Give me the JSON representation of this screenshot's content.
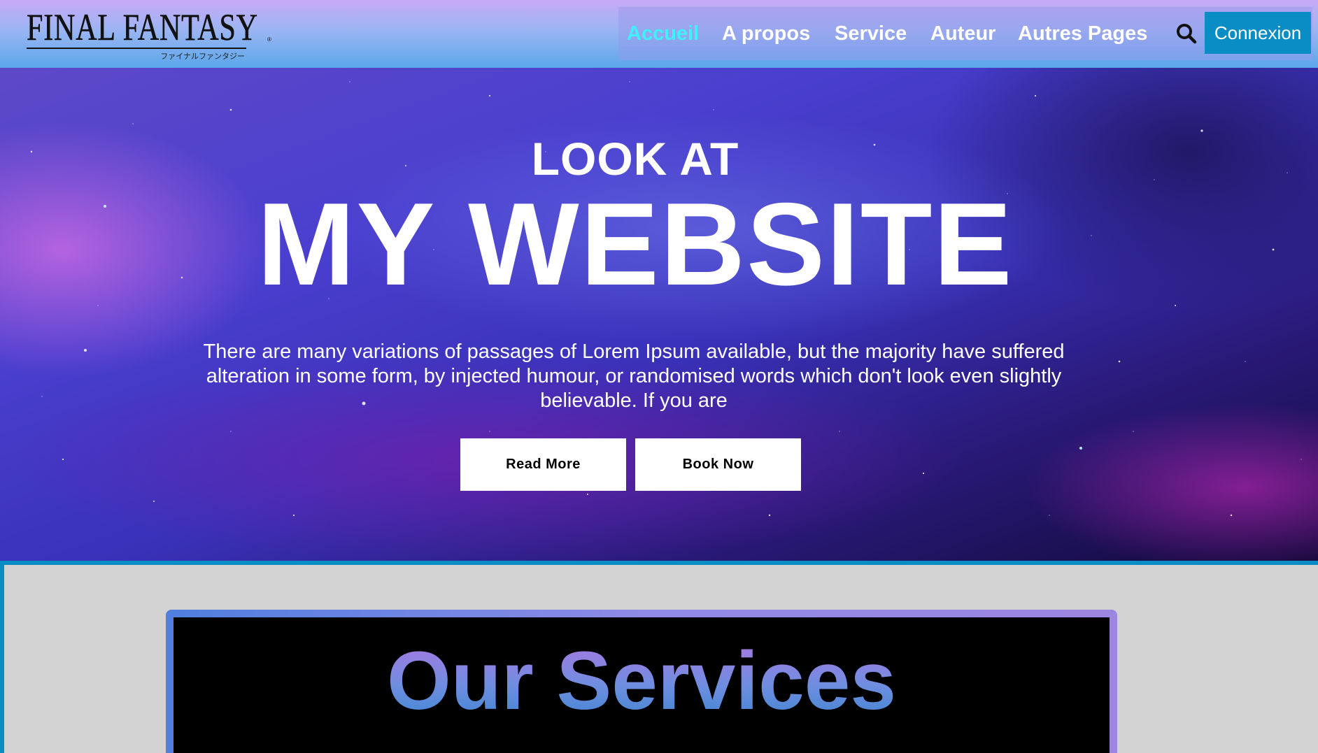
{
  "header": {
    "logo": {
      "main": "FINAL FANTASY",
      "registered": "®",
      "sub": "ファイナルファンタジー"
    },
    "nav": [
      {
        "label": "Accueil",
        "active": true
      },
      {
        "label": "A propos",
        "active": false
      },
      {
        "label": "Service",
        "active": false
      },
      {
        "label": "Auteur",
        "active": false
      },
      {
        "label": "Autres Pages",
        "active": false
      }
    ],
    "search_icon": "search-icon",
    "login_label": "Connexion"
  },
  "hero": {
    "kicker": "LOOK AT",
    "title": "MY WEBSITE",
    "text": "There are many variations of passages of Lorem Ipsum available, but the majority have suffered alteration in some form, by injected humour, or randomised words which don't look even slightly believable. If you are",
    "buttons": {
      "read_more": "Read More",
      "book_now": "Book Now"
    }
  },
  "services": {
    "title": "Our Services"
  },
  "colors": {
    "accent": "#0a8cc4",
    "nav_active": "#3ff0f8",
    "page_bg": "#d3d3d3"
  }
}
